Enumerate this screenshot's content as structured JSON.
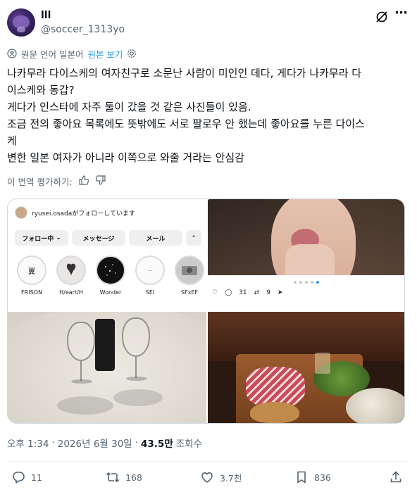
{
  "user": {
    "display_name": "lll",
    "handle": "@soccer_1313yo"
  },
  "translate": {
    "original_language": "원문 언어 일본어",
    "show_original": "원본 보기"
  },
  "tweet": {
    "lines": [
      "나카무라 다이스케의 여자친구로 소문난 사람이 미인인 데다, 게다가 나카무라 다",
      "이스케와 동갑?",
      "게다가 인스타에 자주 둘이 갔을 것 같은 사진들이 있음.",
      "조금 전의 좋아요 목록에도 뜻밖에도 서로 팔로우 안 했는데 좋아요를 누른 다이스",
      "케",
      "변한 일본 여자가 아니라 이쪽으로 와줄 거라는 안심감"
    ]
  },
  "rate": {
    "label": "이 번역 평가하기:"
  },
  "media": {
    "instagram": {
      "followed_by": "ryusei.osadaがフォローしています",
      "buttons": [
        "フォロー中",
        "メッセージ",
        "メール"
      ],
      "highlights": [
        {
          "label": "FRISON",
          "glyph": "翼"
        },
        {
          "label": "H/eart/H",
          "glyph": ""
        },
        {
          "label": "Wonder",
          "glyph": ""
        },
        {
          "label": "SEI",
          "glyph": "~"
        },
        {
          "label": "SFxEF",
          "glyph": ""
        }
      ]
    },
    "photo2": {
      "likes": "31",
      "reposts": "9"
    }
  },
  "meta": {
    "time": "오후 1:34",
    "sep": "·",
    "date": "2026년 6월 30일",
    "views_count": "43.5만",
    "views_label": "조회수"
  },
  "actions": {
    "replies": "11",
    "reposts": "168",
    "likes": "3.7천",
    "bookmarks": "836"
  }
}
